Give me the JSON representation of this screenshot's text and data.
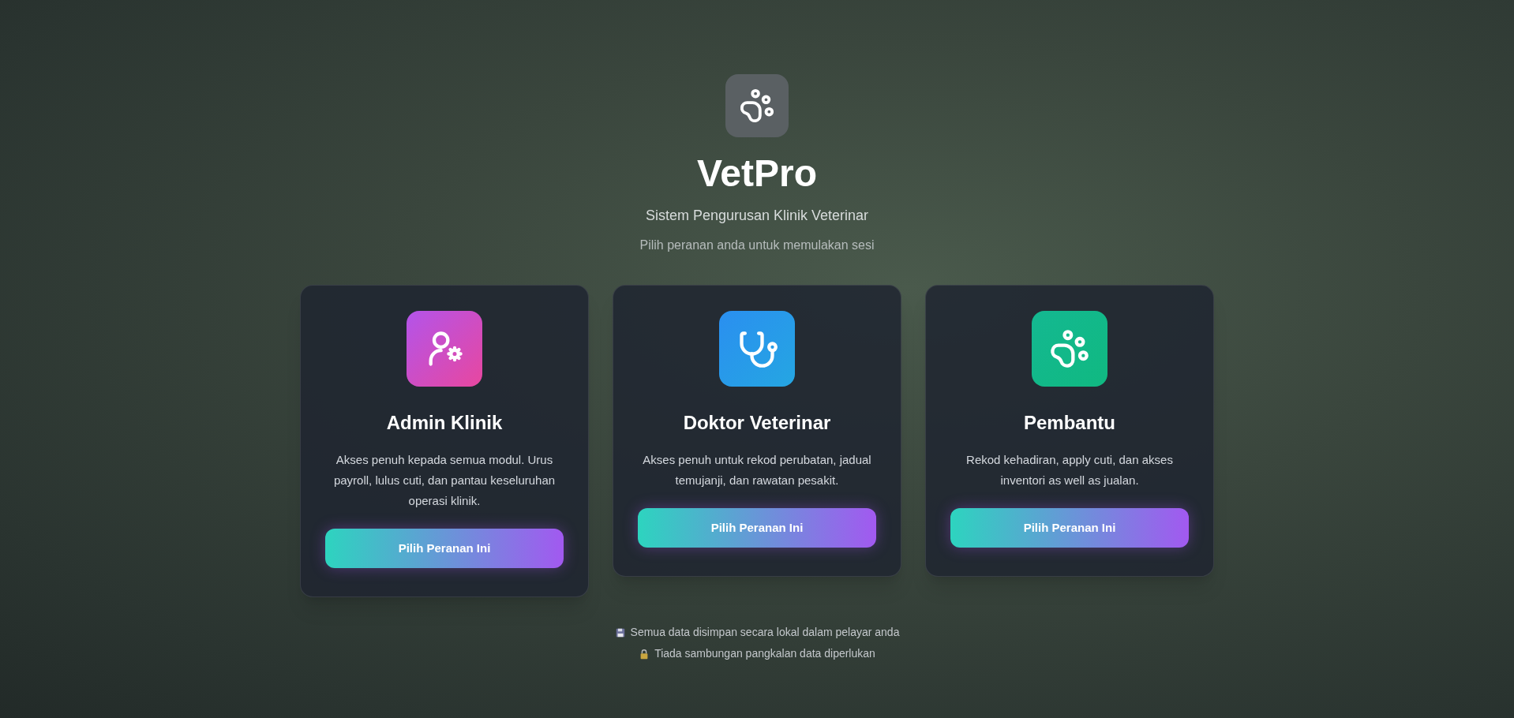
{
  "header": {
    "title": "VetPro",
    "subtitle": "Sistem Pengurusan Klinik Veterinar",
    "hint": "Pilih peranan anda untuk memulakan sesi"
  },
  "roles": [
    {
      "kind": "admin",
      "title": "Admin Klinik",
      "description": "Akses penuh kepada semua modul. Urus payroll, lulus cuti, dan pantau keseluruhan operasi klinik.",
      "button": "Pilih Peranan Ini"
    },
    {
      "kind": "doctor",
      "title": "Doktor Veterinar",
      "description": "Akses penuh untuk rekod perubatan, jadual temujanji, dan rawatan pesakit.",
      "button": "Pilih Peranan Ini"
    },
    {
      "kind": "assistant",
      "title": "Pembantu",
      "description": "Rekod kehadiran, apply cuti, dan akses inventori as well as jualan.",
      "button": "Pilih Peranan Ini"
    }
  ],
  "notes": [
    {
      "kind": "storage",
      "text": "Semua data disimpan secara lokal dalam pelayar anda"
    },
    {
      "kind": "lock",
      "text": "Tiada sambungan pangkalan data diperlukan"
    }
  ]
}
